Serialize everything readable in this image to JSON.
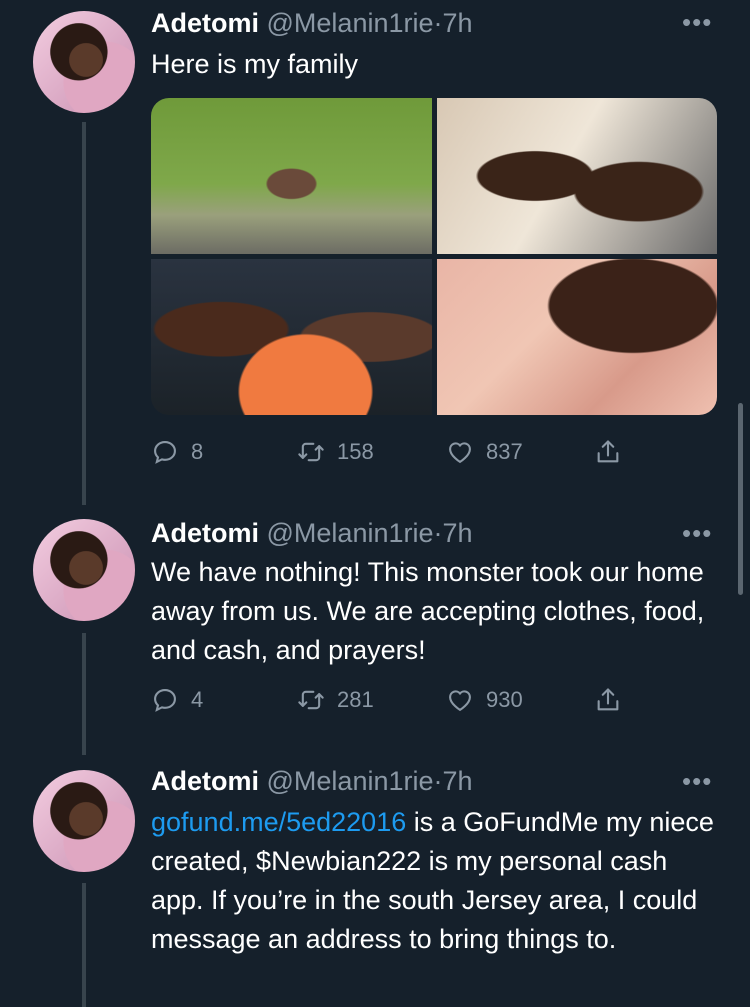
{
  "tweets": [
    {
      "name": "Adetomi",
      "handle": "@Melanin1rie",
      "dot": "·",
      "time": "7h",
      "text": "Here is my family",
      "replies": "8",
      "retweets": "158",
      "likes": "837"
    },
    {
      "name": "Adetomi",
      "handle": "@Melanin1rie",
      "dot": "·",
      "time": "7h",
      "text": "We have nothing! This monster took our home away from us. We are accepting clothes, food, and cash, and prayers!",
      "replies": "4",
      "retweets": "281",
      "likes": "930"
    },
    {
      "name": "Adetomi",
      "handle": "@Melanin1rie",
      "dot": "·",
      "time": "7h",
      "link": "gofund.me/5ed22016",
      "text": " is a GoFundMe my niece created, $Newbian222 is my personal cash app. If you’re in the south Jersey area, I could message an address to bring things to."
    }
  ],
  "more_label": "•••",
  "colors": {
    "background": "#15202b",
    "text": "#ffffff",
    "secondary": "#8b98a5",
    "link": "#1d9bf0"
  },
  "icons": {
    "reply": "reply-icon",
    "retweet": "retweet-icon",
    "like": "heart-icon",
    "share": "share-icon"
  }
}
